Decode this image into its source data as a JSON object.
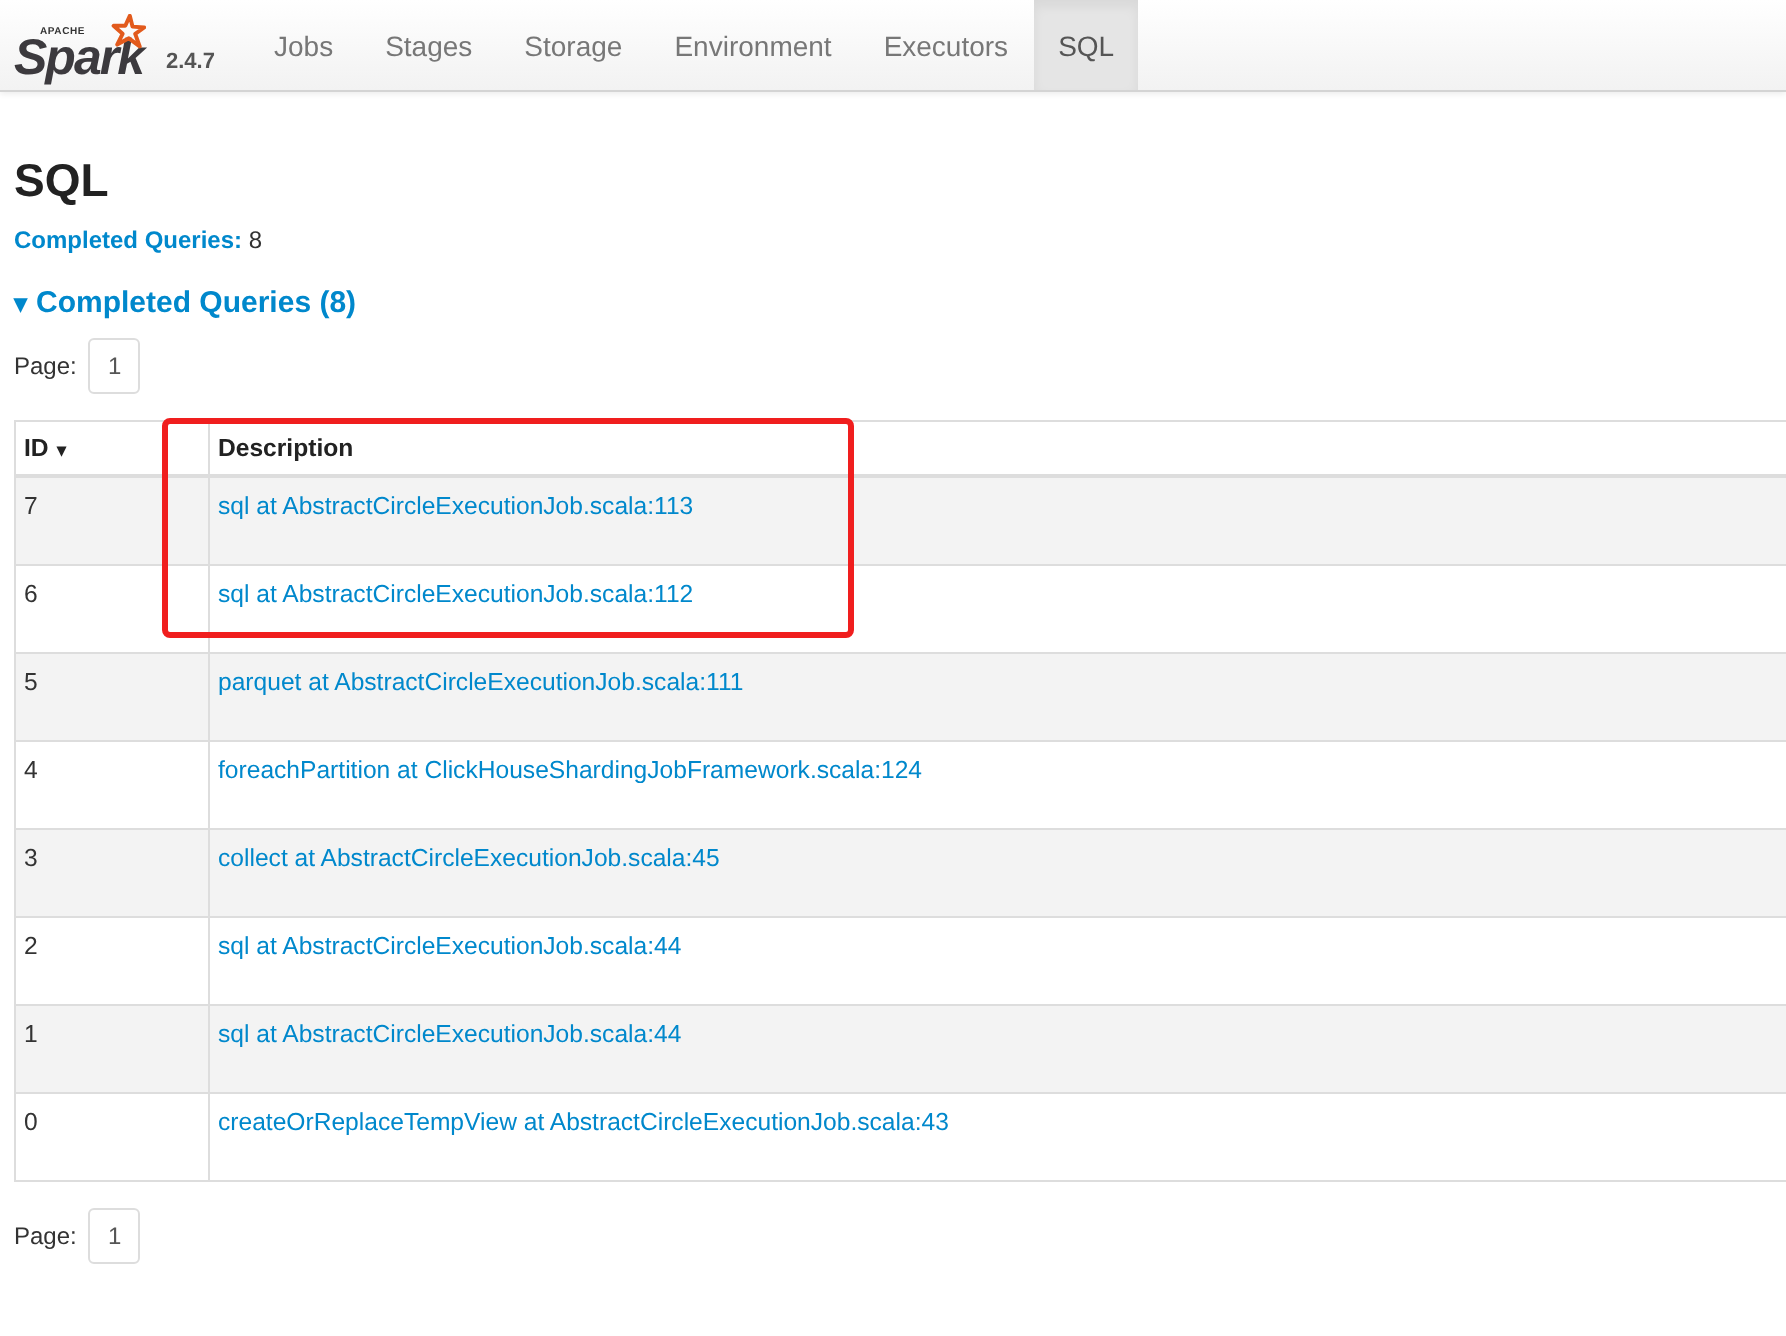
{
  "navbar": {
    "logo": {
      "small": "APACHE",
      "wordmark": "Spark"
    },
    "version": "2.4.7",
    "tabs": [
      {
        "label": "Jobs",
        "selected": false
      },
      {
        "label": "Stages",
        "selected": false
      },
      {
        "label": "Storage",
        "selected": false
      },
      {
        "label": "Environment",
        "selected": false
      },
      {
        "label": "Executors",
        "selected": false
      },
      {
        "label": "SQL",
        "selected": true
      }
    ]
  },
  "page": {
    "title": "SQL",
    "summary": {
      "label": "Completed Queries:",
      "value": "8"
    },
    "section": {
      "caret": "▾",
      "title": "Completed Queries (8)",
      "expanded": true
    },
    "pager_top": {
      "label": "Page:",
      "pages": [
        "1"
      ]
    },
    "table": {
      "columns": [
        {
          "label": "ID",
          "sort": "▾"
        },
        {
          "label": "Description"
        }
      ],
      "rows": [
        {
          "id": "7",
          "description": "sql at AbstractCircleExecutionJob.scala:113"
        },
        {
          "id": "6",
          "description": "sql at AbstractCircleExecutionJob.scala:112"
        },
        {
          "id": "5",
          "description": "parquet at AbstractCircleExecutionJob.scala:111"
        },
        {
          "id": "4",
          "description": "foreachPartition at ClickHouseShardingJobFramework.scala:124"
        },
        {
          "id": "3",
          "description": "collect at AbstractCircleExecutionJob.scala:45"
        },
        {
          "id": "2",
          "description": "sql at AbstractCircleExecutionJob.scala:44"
        },
        {
          "id": "1",
          "description": "sql at AbstractCircleExecutionJob.scala:44"
        },
        {
          "id": "0",
          "description": "createOrReplaceTempView at AbstractCircleExecutionJob.scala:43"
        }
      ]
    },
    "pager_bottom": {
      "label": "Page:",
      "pages": [
        "1"
      ]
    }
  }
}
